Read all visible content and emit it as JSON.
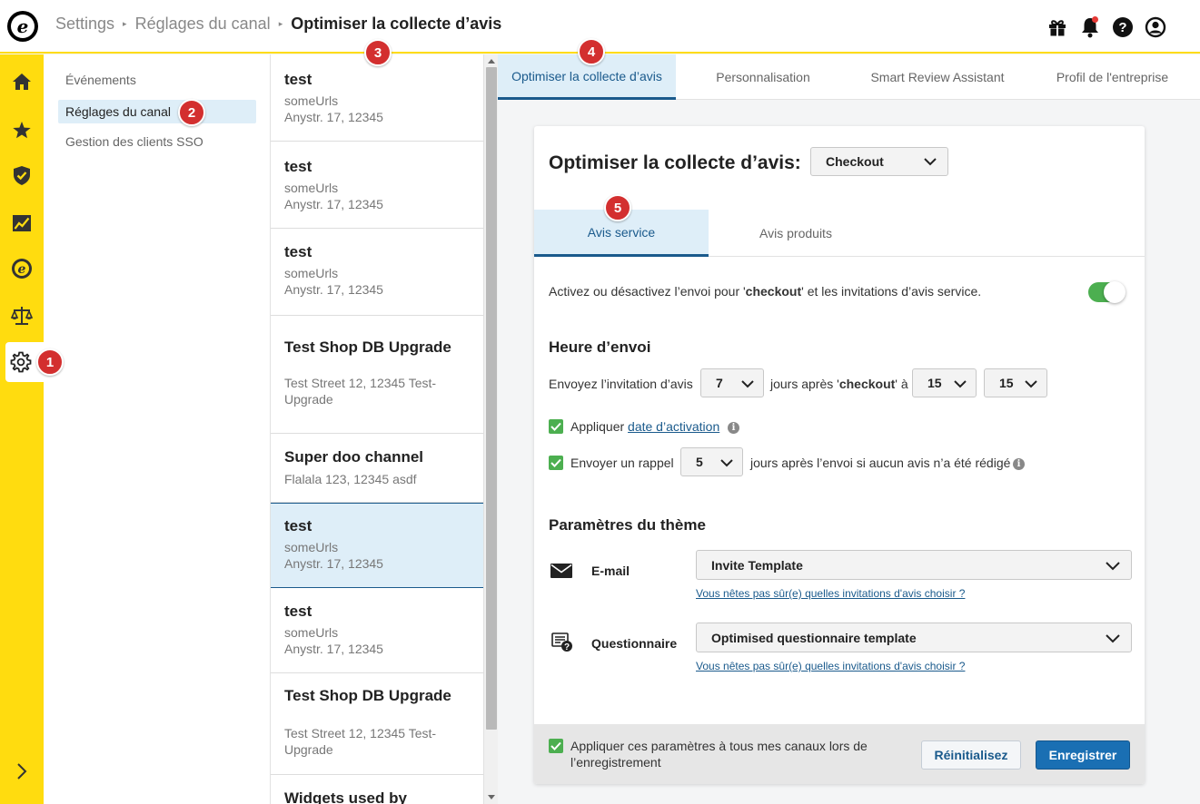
{
  "topbar": {
    "logo_letter": "e",
    "breadcrumbs": [
      "Settings",
      "Réglages du canal",
      "Optimiser la collecte d’avis"
    ],
    "icons": [
      "gift-icon",
      "bell-icon",
      "help-icon",
      "user-icon"
    ]
  },
  "leftnav": {
    "items": [
      "home-icon",
      "star-icon",
      "shield-check-icon",
      "chart-icon",
      "trusted-e-icon",
      "scales-icon",
      "gear-icon"
    ],
    "active": "gear-icon",
    "expand_icon": "chevron-right-icon"
  },
  "subnav": {
    "items": [
      {
        "label": "Événements"
      },
      {
        "label": "Réglages du canal"
      },
      {
        "label": "Gestion des clients SSO"
      }
    ],
    "active_index": 1
  },
  "channels": [
    {
      "name": "test",
      "line1": "someUrls",
      "line2": "Anystr. 17, 12345"
    },
    {
      "name": "test",
      "line1": "someUrls",
      "line2": "Anystr. 17, 12345"
    },
    {
      "name": "test",
      "line1": "someUrls",
      "line2": "Anystr. 17, 12345"
    },
    {
      "name": "Test Shop DB Upgrade",
      "line1": "Test Street 12, 12345 Test-",
      "line2": "Upgrade"
    },
    {
      "name": "Super doo channel",
      "line1": "Flalala 123, 12345 asdf",
      "line2": ""
    },
    {
      "name": "test",
      "line1": "someUrls",
      "line2": "Anystr. 17, 12345"
    },
    {
      "name": "test",
      "line1": "someUrls",
      "line2": "Anystr. 17, 12345"
    },
    {
      "name": "Test Shop DB Upgrade",
      "line1": "Test Street 12, 12345 Test-",
      "line2": "Upgrade"
    },
    {
      "name": "Widgets used by",
      "line1": "",
      "line2": ""
    }
  ],
  "channels_selected_index": 5,
  "tabs": [
    "Optimiser la collecte d’avis",
    "Personnalisation",
    "Smart Review Assistant",
    "Profil de l'entreprise"
  ],
  "tabs_active_index": 0,
  "card": {
    "title": "Optimiser la collecte d’avis:",
    "type_select": "Checkout",
    "subtabs": [
      "Avis service",
      "Avis produits"
    ],
    "subtabs_active_index": 0,
    "toggle_text_pre": "Activez ou désactivez l’envoi pour '",
    "toggle_text_bold": "checkout",
    "toggle_text_post": "' et les invitations d’avis service.",
    "toggle_on": true,
    "send_time_heading": "Heure d’envoi",
    "send_label": "Envoyez l’invitation d’avis",
    "days_value": "7",
    "after_pre": "jours après '",
    "after_bold": "checkout",
    "after_post": "' à",
    "hour_value": "15",
    "minute_value": "15",
    "apply_label": "Appliquer",
    "activation_link": "date d’activation",
    "reminder_label": "Envoyer un rappel",
    "reminder_days": "5",
    "reminder_text": "jours après l’envoi si aucun avis n’a été rédigé",
    "theme_heading": "Paramètres du thème",
    "email_label": "E-mail",
    "email_template": "Invite Template",
    "email_help_link": "Vous nêtes pas sûr(e) quelles invitations d'avis choisir ?",
    "questionnaire_label": "Questionnaire",
    "questionnaire_template": "Optimised questionnaire template",
    "questionnaire_help_link": "Vous nêtes pas sûr(e) quelles invitations d'avis choisir ?",
    "footer_checkbox_line1": "Appliquer ces paramètres à tous mes canaux lors de",
    "footer_checkbox_line2": "l’enregistrement",
    "reset_button": "Réinitialisez",
    "save_button": "Enregistrer"
  },
  "badges": [
    "1",
    "2",
    "3",
    "4",
    "5"
  ],
  "colors": {
    "brand_yellow": "#ffdc0f",
    "accent_blue": "#1a5a8c",
    "active_bg": "#deeef8",
    "toggle_green": "#4caf50",
    "badge_red": "#d32f2f"
  }
}
